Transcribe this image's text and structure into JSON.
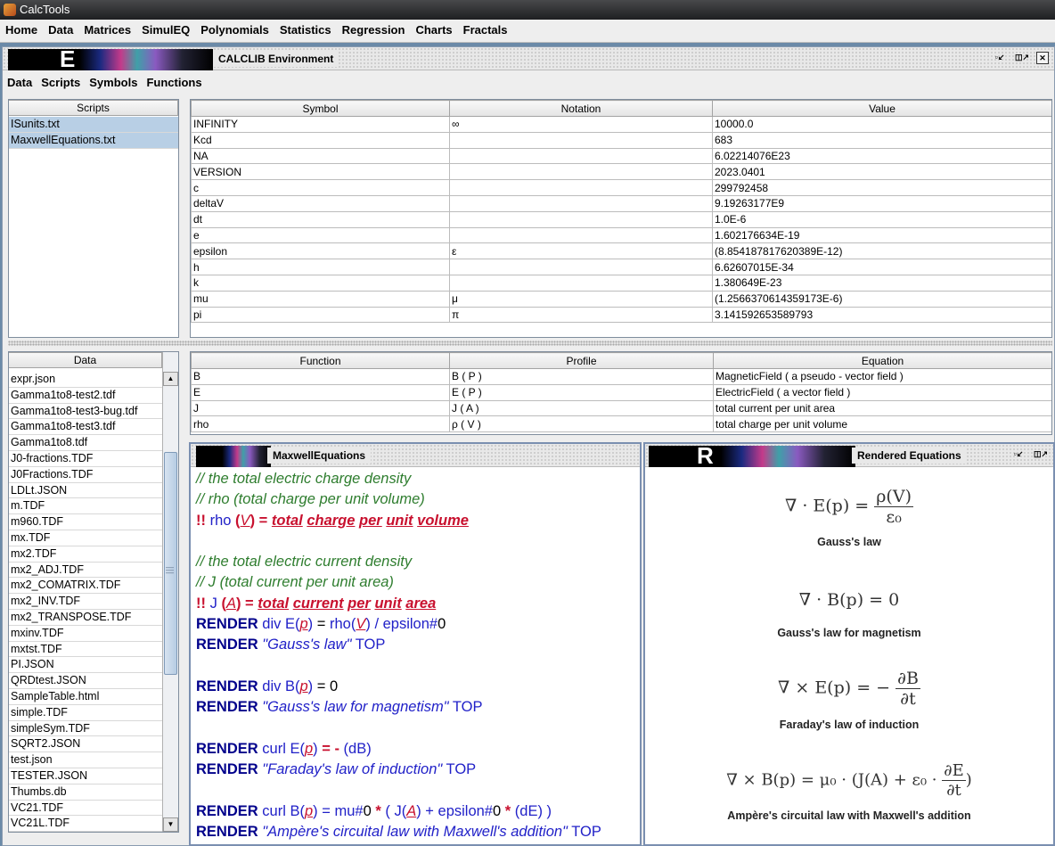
{
  "window": {
    "title": "CalcTools"
  },
  "menu": [
    "Home",
    "Data",
    "Matrices",
    "SimulEQ",
    "Polynomials",
    "Statistics",
    "Regression",
    "Charts",
    "Fractals"
  ],
  "env": {
    "title": "CALCLIB Environment",
    "banner_letter": "E",
    "menu": [
      "Data",
      "Scripts",
      "Symbols",
      "Functions"
    ]
  },
  "scripts": {
    "header": "Scripts",
    "items": [
      "ISunits.txt",
      "MaxwellEquations.txt"
    ]
  },
  "symbols": {
    "headers": [
      "Symbol",
      "Notation",
      "Value"
    ],
    "rows": [
      [
        "INFINITY",
        "∞",
        "10000.0"
      ],
      [
        "Kcd",
        "",
        "683"
      ],
      [
        "NA",
        "",
        "6.02214076E23"
      ],
      [
        "VERSION",
        "",
        "2023.0401"
      ],
      [
        "c",
        "",
        "299792458"
      ],
      [
        "deltaV",
        "",
        "9.19263177E9"
      ],
      [
        "dt",
        "",
        "1.0E-6"
      ],
      [
        "e",
        "",
        "1.602176634E-19"
      ],
      [
        "epsilon",
        "ε",
        "(8.854187817620389E-12)"
      ],
      [
        "h",
        "",
        "6.62607015E-34"
      ],
      [
        "k",
        "",
        "1.380649E-23"
      ],
      [
        "mu",
        "μ",
        "(1.2566370614359173E-6)"
      ],
      [
        "pi",
        "π",
        "3.141592653589793"
      ]
    ]
  },
  "data_list": {
    "header": "Data",
    "items": [
      "expr.json",
      "Gamma1to8-test2.tdf",
      "Gamma1to8-test3-bug.tdf",
      "Gamma1to8-test3.tdf",
      "Gamma1to8.tdf",
      "J0-fractions.TDF",
      "J0Fractions.TDF",
      "LDLt.JSON",
      "m.TDF",
      "m960.TDF",
      "mx.TDF",
      "mx2.TDF",
      "mx2_ADJ.TDF",
      "mx2_COMATRIX.TDF",
      "mx2_INV.TDF",
      "mx2_TRANSPOSE.TDF",
      "mxinv.TDF",
      "mxtst.TDF",
      "PI.JSON",
      "QRDtest.JSON",
      "SampleTable.html",
      "simple.TDF",
      "simpleSym.TDF",
      "SQRT2.JSON",
      "test.json",
      "TESTER.JSON",
      "Thumbs.db",
      "VC21.TDF",
      "VC21L.TDF"
    ]
  },
  "functions": {
    "headers": [
      "Function",
      "Profile",
      "Equation"
    ],
    "rows": [
      [
        "B",
        "B ( P )",
        "MagneticField ( a pseudo - vector field )"
      ],
      [
        "E",
        "E ( P )",
        "ElectricField ( a vector field )"
      ],
      [
        "J",
        "J ( A )",
        "total current per unit area"
      ],
      [
        "rho",
        "ρ ( V )",
        "total charge per unit volume"
      ]
    ]
  },
  "editor": {
    "title": "MaxwellEquations",
    "c1": "//  the total electric charge density",
    "c2": "//             rho (total charge per unit volume)",
    "c3": "//  the total electric current density",
    "c4": "//             J (total current per unit area)",
    "bang": "!!",
    "rho": "rho",
    "V": "V",
    "J": "J",
    "A": "A",
    "p": "p",
    "total": "total",
    "charge": "charge",
    "current": "current",
    "per": "per",
    "unit": "unit",
    "volume": "volume",
    "area": "area",
    "render": "RENDER",
    "div_e": "div E(",
    "div_b": "div B(",
    "curl_e": "curl E(",
    "curl_b": "curl B(",
    "rho_open": "rho(",
    "slash_eps": "/ epsilon#",
    "zero": "0",
    "eq0": "= 0",
    "neg": "= -",
    "dB": "(dB)",
    "mu": "= mu#",
    "times1": "*",
    "open_J": "( J(",
    "plus_eps": "+ epsilon#",
    "times2": "*",
    "dE": "(dE)",
    "close": ")",
    "top": "TOP",
    "sym_close": ")",
    "sym_eq": "=",
    "s_gauss": "\"Gauss's law\"",
    "s_gaussmag": "\"Gauss's law for magnetism\"",
    "s_faraday": "\"Faraday's law of induction\"",
    "s_ampere": "\"Ampère's circuital law with Maxwell's addition\""
  },
  "rendered": {
    "title": "Rendered Equations",
    "banner_letter": "R",
    "eq1": {
      "lhs": "∇ · E(p) =",
      "num": "ρ(V)",
      "den": "ε₀"
    },
    "eq2": {
      "text": "∇ · B(p) = 0"
    },
    "eq3": {
      "lhs": "∇ × E(p) = −",
      "num": "∂B",
      "den": "∂t"
    },
    "eq4": {
      "lhs": "∇ × B(p) = μ₀ · (J(A) + ε₀ ·",
      "num": "∂E",
      "den": "∂t",
      "close": ")"
    },
    "captions": [
      "Gauss's law",
      "Gauss's law for magnetism",
      "Faraday's law of induction",
      "Ampère's circuital law with Maxwell's addition"
    ]
  }
}
